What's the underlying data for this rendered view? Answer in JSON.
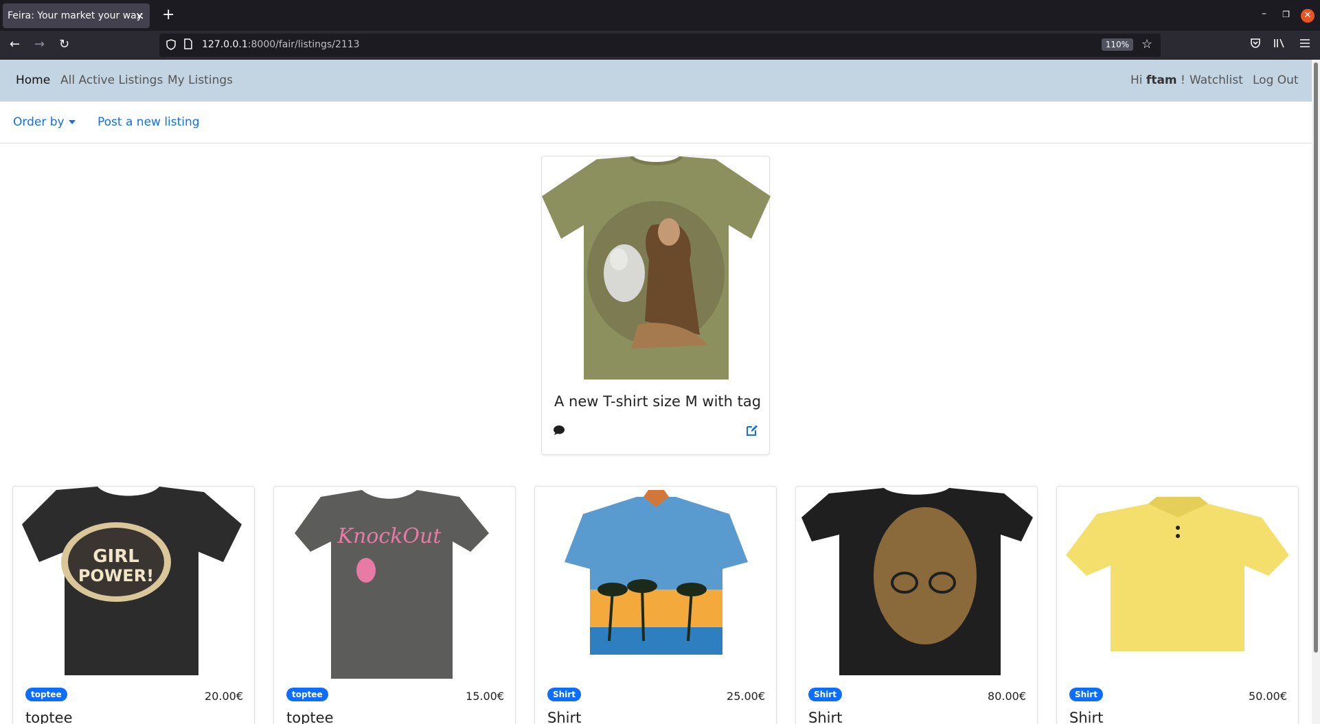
{
  "browser": {
    "tab_title": "Feira: Your market your way.",
    "tab_close": "×",
    "new_tab": "+",
    "url_host": "127.0.0.1",
    "url_rest": ":8000/fair/listings/2113",
    "zoom": "110%"
  },
  "nav": {
    "home": "Home",
    "all_active": "All Active Listings",
    "my_listings": "My Listings",
    "greeting_hi": "Hi",
    "username": "ftam",
    "greeting_end": "!",
    "watchlist": "Watchlist",
    "logout": "Log Out"
  },
  "subnav": {
    "order_by": "Order by",
    "post_new": "Post a new listing"
  },
  "featured": {
    "title": "A new T-shirt size M with tag",
    "image": "olive t-shirt with woman and wolf print"
  },
  "listings": [
    {
      "tag": "toptee",
      "price": "20.00€",
      "title": "toptee",
      "image": "black t-shirt girl power print"
    },
    {
      "tag": "toptee",
      "price": "15.00€",
      "title": "toptee",
      "image": "grey t-shirt knock out print"
    },
    {
      "tag": "Shirt",
      "price": "25.00€",
      "title": "Shirt",
      "image": "blue hawaiian shirt palm trees"
    },
    {
      "tag": "Shirt",
      "price": "80.00€",
      "title": "Shirt",
      "image": "black t-shirt with face print"
    },
    {
      "tag": "Shirt",
      "price": "50.00€",
      "title": "Shirt",
      "image": "yellow polo shirt"
    }
  ],
  "colors": {
    "nav_bg": "#c3d4e2",
    "link": "#0d6efd",
    "badge": "#0d6efd"
  }
}
